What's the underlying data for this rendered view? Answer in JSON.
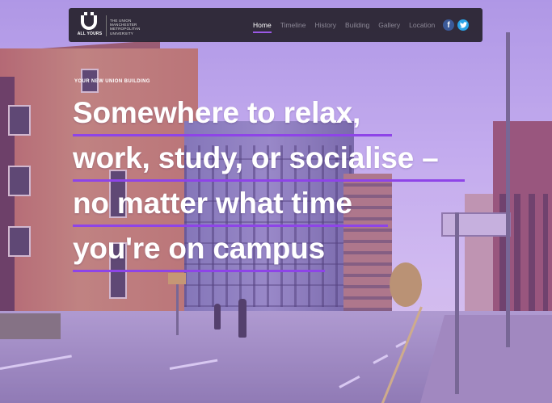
{
  "nav": {
    "logo_text": "ALL YOURS",
    "university_lines": [
      "THE UNION",
      "MANCHESTER",
      "METROPOLITAN",
      "UNIVERSITY"
    ],
    "links": [
      "Home",
      "Timeline",
      "History",
      "Building",
      "Gallery",
      "Location"
    ],
    "active_link": "Home",
    "social": [
      {
        "name": "facebook-icon",
        "glyph": "f",
        "color": "#3b5998"
      },
      {
        "name": "twitter-icon",
        "glyph": "t",
        "color": "#2aa3e6"
      }
    ]
  },
  "hero": {
    "eyebrow": "YOUR NEW UNION BUILDING",
    "headline_lines": [
      "Somewhere to relax,",
      "work, study, or socialise –",
      "no matter what time",
      "you're on campus"
    ],
    "accent_color": "#8e44e8"
  }
}
